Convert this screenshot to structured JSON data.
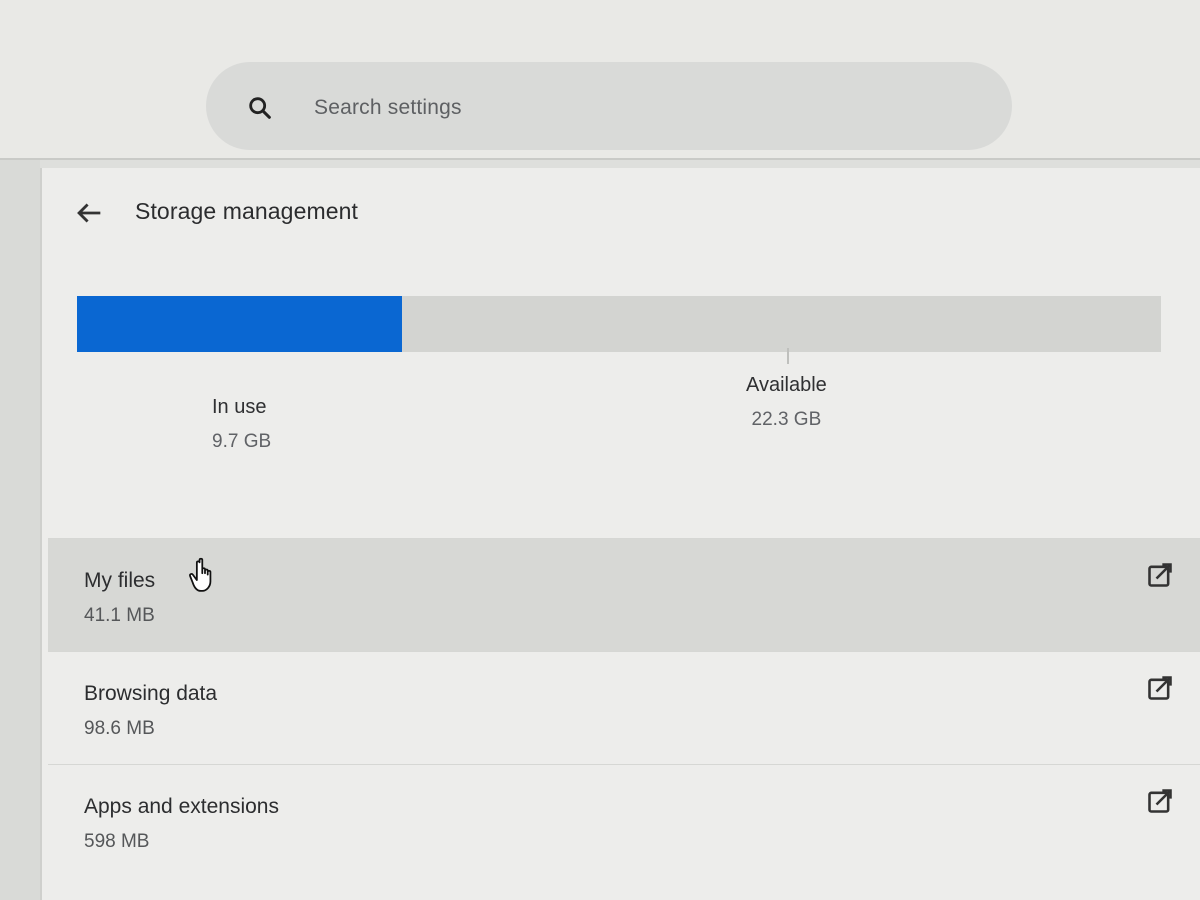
{
  "search": {
    "placeholder": "Search settings",
    "icon": "search-icon"
  },
  "header": {
    "title": "Storage management",
    "back_icon": "arrow-back-icon"
  },
  "storage": {
    "used_fraction": 0.3,
    "in_use": {
      "label": "In use",
      "value": "9.7 GB"
    },
    "available": {
      "label": "Available",
      "value": "22.3 GB"
    },
    "bar_color": "#0a67d2"
  },
  "rows": [
    {
      "label": "My files",
      "value": "41.1 MB",
      "icon": "open-external-icon"
    },
    {
      "label": "Browsing data",
      "value": "98.6 MB",
      "icon": "open-external-icon"
    },
    {
      "label": "Apps and extensions",
      "value": "598 MB",
      "icon": "open-external-icon"
    }
  ]
}
